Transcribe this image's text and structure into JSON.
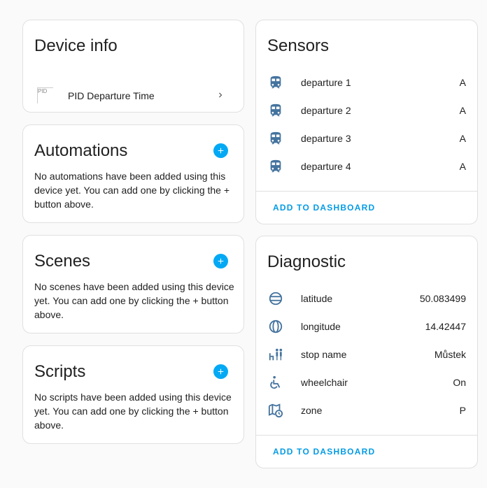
{
  "device_info": {
    "title": "Device info",
    "device_name": "PID Departure Time",
    "image_alt": "PID"
  },
  "automations": {
    "title": "Automations",
    "description": "No automations have been added using this device yet. You can add one by clicking the + button above."
  },
  "scenes": {
    "title": "Scenes",
    "description": "No scenes have been added using this device yet. You can add one by clicking the + button above."
  },
  "scripts": {
    "title": "Scripts",
    "description": "No scripts have been added using this device yet. You can add one by clicking the + button above."
  },
  "sensors": {
    "title": "Sensors",
    "items": [
      {
        "name": "departure 1",
        "value": "A",
        "icon": "train-icon"
      },
      {
        "name": "departure 2",
        "value": "A",
        "icon": "train-icon"
      },
      {
        "name": "departure 3",
        "value": "A",
        "icon": "train-icon"
      },
      {
        "name": "departure 4",
        "value": "A",
        "icon": "train-icon"
      }
    ],
    "add_to_dashboard": "ADD TO DASHBOARD"
  },
  "diagnostic": {
    "title": "Diagnostic",
    "items": [
      {
        "name": "latitude",
        "value": "50.083499",
        "icon": "latitude-icon"
      },
      {
        "name": "longitude",
        "value": "14.42447",
        "icon": "longitude-icon"
      },
      {
        "name": "stop name",
        "value": "Můstek",
        "icon": "bus-stop-icon"
      },
      {
        "name": "wheelchair",
        "value": "On",
        "icon": "wheelchair-icon"
      },
      {
        "name": "zone",
        "value": "P",
        "icon": "map-clock-icon"
      }
    ],
    "add_to_dashboard": "ADD TO DASHBOARD"
  },
  "colors": {
    "accent": "#03a9f4",
    "link": "#039be5",
    "icon": "#44739e"
  }
}
